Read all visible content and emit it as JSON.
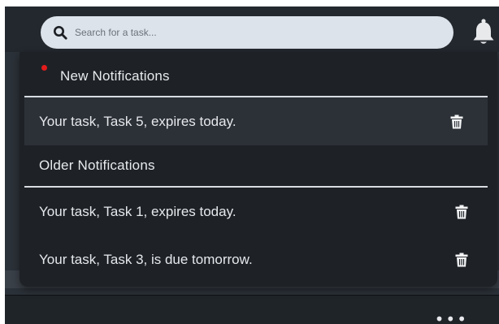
{
  "search": {
    "placeholder": "Search for a task..."
  },
  "icons": {
    "search": "search-icon",
    "bell": "bell-icon",
    "trash": "trash-icon",
    "more": "more-horizontal-icon"
  },
  "notifications": {
    "new_header": "New Notifications",
    "new_items": [
      {
        "text": "Your task, Task 5, expires today."
      }
    ],
    "older_header": "Older Notifications",
    "older_items": [
      {
        "text": "Your task, Task 1, expires today."
      },
      {
        "text": "Your task, Task 3, is due tomorrow."
      }
    ]
  },
  "more_label": "•••",
  "colors": {
    "unread_dot": "#e31b1b",
    "dropdown_bg": "#1e2227",
    "highlight_row": "#2c3138",
    "search_bg": "#dde3ea"
  }
}
